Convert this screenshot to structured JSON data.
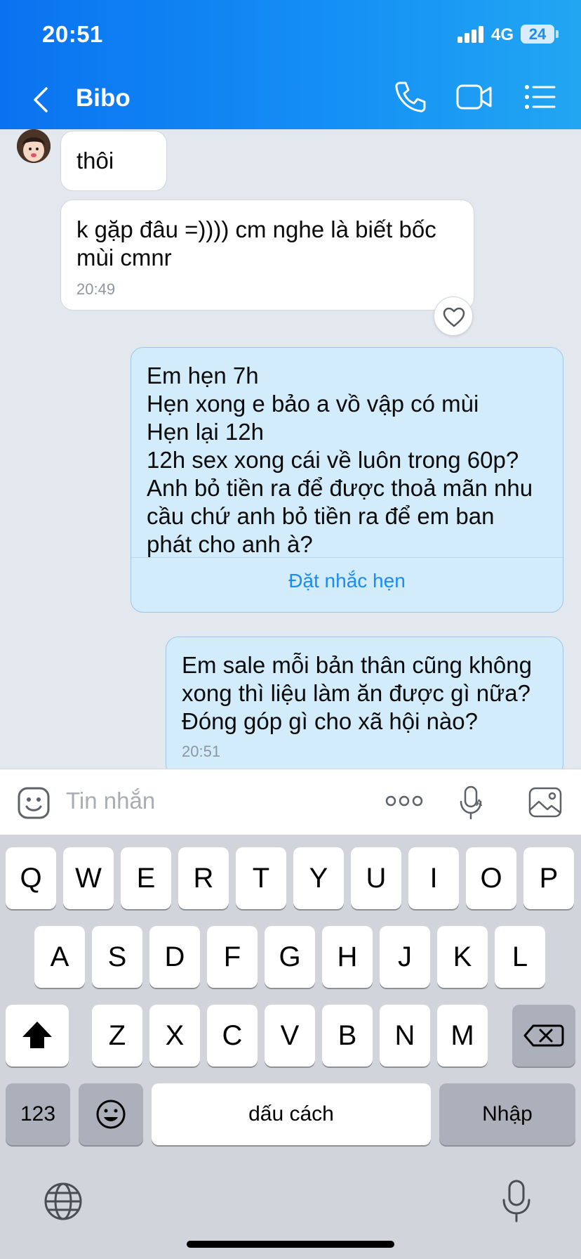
{
  "status_bar": {
    "time": "20:51",
    "network": "4G",
    "battery": "24"
  },
  "header": {
    "contact_name": "Bibo",
    "icons": [
      "back-chevron-icon",
      "phone-icon",
      "video-call-icon",
      "menu-list-icon"
    ]
  },
  "messages": [
    {
      "side": "in",
      "text": "thôi"
    },
    {
      "side": "in",
      "text": "k gặp đâu =)))) cm nghe là biết bốc\nmùi cmnr",
      "time": "20:49",
      "reaction": "heart-icon"
    },
    {
      "side": "out",
      "text": "Em hẹn 7h\nHẹn xong e bảo a vồ vập có mùi\nHẹn lại 12h\n12h sex xong cái về luôn trong 60p?\nAnh bỏ tiền ra để được thoả mãn nhu\ncầu chứ anh bỏ tiền ra để em ban\nphát cho anh à?",
      "action": "Đặt nhắc hẹn"
    },
    {
      "side": "out",
      "text": "Em sale mỗi bản thân cũng không\nxong thì liệu làm ăn được gì nữa?\nĐóng góp gì cho xã hội nào?",
      "time": "20:51"
    }
  ],
  "input": {
    "placeholder": "Tin nhắn",
    "icons": [
      "sticker-icon",
      "more-icon",
      "voice-to-text-icon",
      "image-icon"
    ]
  },
  "keyboard": {
    "row1": [
      "Q",
      "W",
      "E",
      "R",
      "T",
      "Y",
      "U",
      "I",
      "O",
      "P"
    ],
    "row2": [
      "A",
      "S",
      "D",
      "F",
      "G",
      "H",
      "J",
      "K",
      "L"
    ],
    "row3": [
      "Z",
      "X",
      "C",
      "V",
      "B",
      "N",
      "M"
    ],
    "numbers_key": "123",
    "space_key": "dấu cách",
    "return_key": "Nhập",
    "icons": [
      "shift-icon",
      "backspace-icon",
      "emoji-icon",
      "globe-icon",
      "dictation-mic-icon"
    ]
  },
  "colors": {
    "header_start": "#0a72f0",
    "header_end": "#22a6f2",
    "out_bubble": "#d3ecfb",
    "accent": "#1a8cf4"
  }
}
